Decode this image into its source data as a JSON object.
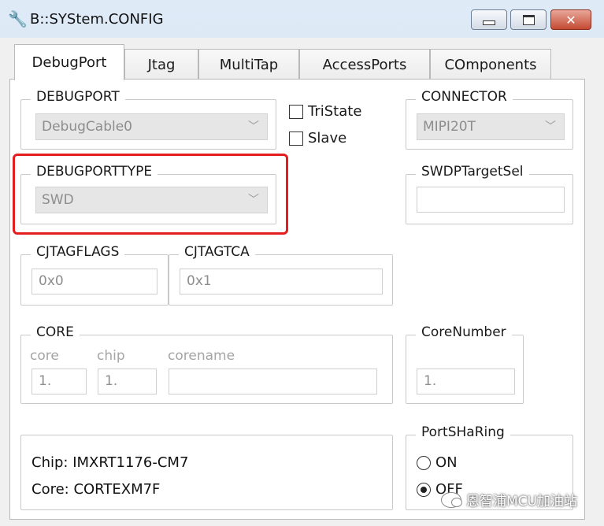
{
  "window": {
    "title": "B::SYStem.CONFIG",
    "icons": {
      "app": "wrench-icon",
      "minimize": "minimize-icon",
      "maximize": "maximize-icon",
      "close": "close-icon"
    }
  },
  "tabs": [
    {
      "label": "DebugPort",
      "active": true
    },
    {
      "label": "Jtag",
      "active": false
    },
    {
      "label": "MultiTap",
      "active": false
    },
    {
      "label": "AccessPorts",
      "active": false
    },
    {
      "label": "COmponents",
      "active": false
    }
  ],
  "debugport": {
    "legend": "DEBUGPORT",
    "value": "DebugCable0"
  },
  "options": {
    "tristate": "TriState",
    "slave": "Slave"
  },
  "connector": {
    "legend": "CONNECTOR",
    "value": "MIPI20T"
  },
  "debugporttype": {
    "legend": "DEBUGPORTTYPE",
    "value": "SWD"
  },
  "swdptargetsel": {
    "legend": "SWDPTargetSel",
    "value": ""
  },
  "cjtagflags": {
    "legend": "CJTAGFLAGS",
    "value": "0x0"
  },
  "cjtagtca": {
    "legend": "CJTAGTCA",
    "value": "0x1"
  },
  "core": {
    "legend": "CORE",
    "core_label": "core",
    "core_value": "1.",
    "chip_label": "chip",
    "chip_value": "1.",
    "corename_label": "corename",
    "corename_value": ""
  },
  "corenumber": {
    "legend": "CoreNumber",
    "value": "1."
  },
  "info": {
    "chip": "Chip: IMXRT1176-CM7",
    "core": "Core: CORTEXM7F"
  },
  "portsharing": {
    "legend": "PortSHaRing",
    "on": "ON",
    "off": "OFF",
    "selected": "OFF"
  },
  "highlight": {
    "color": "#e41e1e"
  },
  "watermark": {
    "text": "恩智浦MCU加油站"
  }
}
